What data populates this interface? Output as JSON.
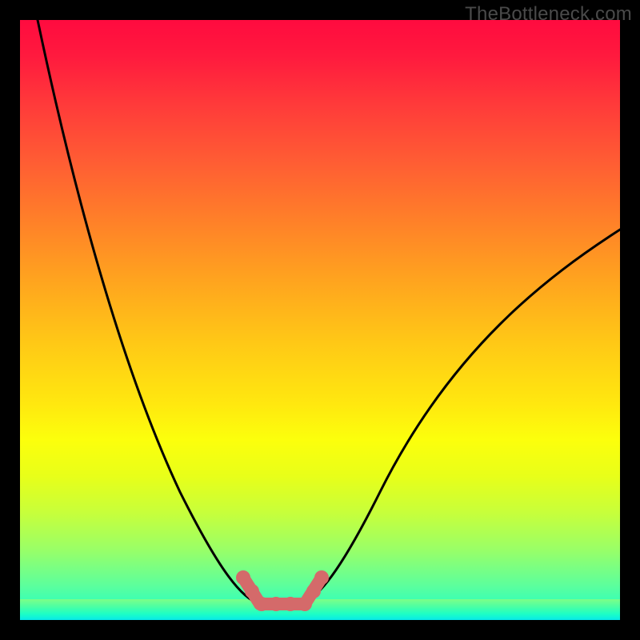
{
  "watermark": "TheBottleneck.com",
  "colors": {
    "background": "#000000",
    "curve": "#000000",
    "marker": "#d46a6a",
    "gradient_top": "#ff0b3f",
    "gradient_bottom": "#15ffd0"
  },
  "chart_data": {
    "type": "line",
    "title": "",
    "xlabel": "",
    "ylabel": "",
    "xlim": [
      0,
      100
    ],
    "ylim": [
      0,
      100
    ],
    "grid": false,
    "legend": false,
    "series": [
      {
        "name": "bottleneck-curve",
        "x": [
          3,
          6,
          10,
          14,
          18,
          22,
          26,
          30,
          34,
          37,
          39,
          41,
          43,
          45,
          47,
          50,
          53,
          57,
          62,
          68,
          75,
          82,
          90,
          100
        ],
        "y": [
          100,
          88,
          74,
          61,
          49,
          38,
          28,
          19,
          11,
          6,
          3.5,
          2.2,
          1.8,
          1.8,
          2.2,
          3.5,
          6,
          10,
          16,
          24,
          33,
          42,
          51,
          62
        ]
      }
    ],
    "annotations": [
      {
        "name": "optimal-band-markers",
        "x_range": [
          38,
          48
        ],
        "y": 2,
        "style": "thick-pink-dots"
      }
    ]
  }
}
